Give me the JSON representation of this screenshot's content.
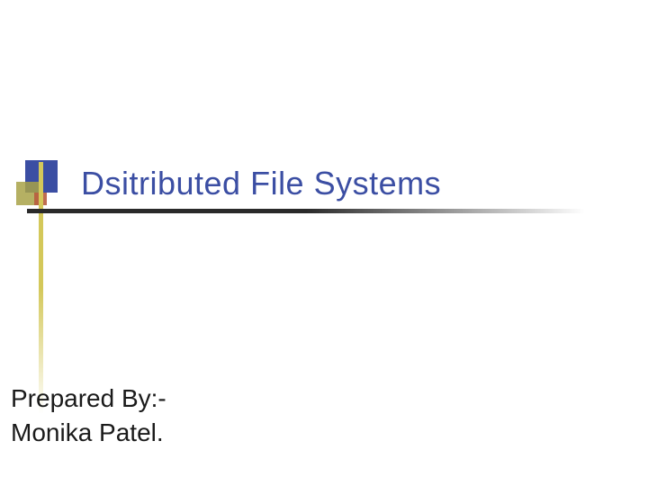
{
  "slide": {
    "title": "Dsitributed File Systems",
    "author_label": "Prepared By:-",
    "author_name": "Monika Patel."
  }
}
